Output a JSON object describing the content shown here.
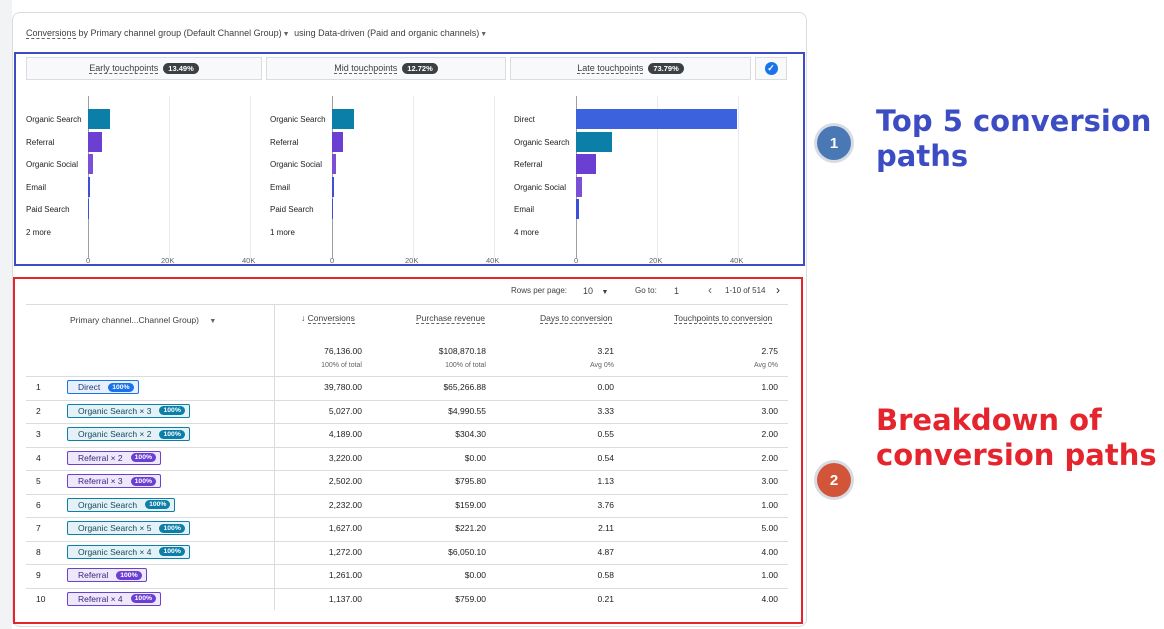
{
  "report": {
    "title_link": "Conversions",
    "title_mid": "by Primary channel group (Default Channel Group)",
    "title_using": "using",
    "title_model": "Data-driven (Paid and organic channels)"
  },
  "touchpoint_tabs": [
    {
      "label": "Early touchpoints",
      "pct": "13.49%"
    },
    {
      "label": "Mid touchpoints",
      "pct": "12.72%"
    },
    {
      "label": "Late touchpoints",
      "pct": "73.79%"
    }
  ],
  "chart_data": [
    {
      "type": "bar",
      "categories": [
        "Organic Search",
        "Referral",
        "Organic Social",
        "Email",
        "Paid Search",
        "2 more"
      ],
      "values": [
        5400,
        3400,
        1200,
        500,
        300,
        80
      ],
      "colors": [
        "#0b7fa8",
        "#6a3fd1",
        "#7b4fd6",
        "#3d4fd8",
        "#3d4fd8",
        "#9aa0a6"
      ],
      "xticks": [
        "0",
        "20K",
        "40K"
      ],
      "xlim": [
        0,
        40000
      ]
    },
    {
      "type": "bar",
      "categories": [
        "Organic Search",
        "Referral",
        "Organic Social",
        "Email",
        "Paid Search",
        "1 more"
      ],
      "values": [
        5400,
        2800,
        900,
        600,
        150,
        80
      ],
      "colors": [
        "#0b7fa8",
        "#6a3fd1",
        "#7b4fd6",
        "#3d4fd8",
        "#3d4fd8",
        "#9aa0a6"
      ],
      "xticks": [
        "0",
        "20K",
        "40K"
      ],
      "xlim": [
        0,
        40000
      ]
    },
    {
      "type": "bar",
      "categories": [
        "Direct",
        "Organic Search",
        "Referral",
        "Organic Social",
        "Email",
        "4 more"
      ],
      "values": [
        39780,
        9000,
        5000,
        1400,
        700,
        150
      ],
      "colors": [
        "#3c63dd",
        "#0b7fa8",
        "#6a3fd1",
        "#7b4fd6",
        "#3d4fd8",
        "#9aa0a6"
      ],
      "xticks": [
        "0",
        "20K",
        "40K"
      ],
      "xlim": [
        0,
        40000
      ]
    }
  ],
  "table": {
    "rows_per_page_label": "Rows per page:",
    "rows_per_page": "10",
    "goto_label": "Go to:",
    "goto_value": "1",
    "range": "1-10 of 514",
    "dimension_header": "Primary channel...Channel Group)",
    "columns": [
      "Conversions",
      "Purchase revenue",
      "Days to conversion",
      "Touchpoints to conversion"
    ],
    "totals": [
      "76,136.00",
      "$108,870.18",
      "3.21",
      "2.75"
    ],
    "totals_sub": [
      "100% of total",
      "100% of total",
      "Avg 0%",
      "Avg 0%"
    ],
    "rows": [
      {
        "n": "1",
        "path": "Direct",
        "pct": "100%",
        "color": "blue",
        "v": [
          "39,780.00",
          "$65,266.88",
          "0.00",
          "1.00"
        ]
      },
      {
        "n": "2",
        "path": "Organic Search × 3",
        "pct": "100%",
        "color": "teal",
        "v": [
          "5,027.00",
          "$4,990.55",
          "3.33",
          "3.00"
        ]
      },
      {
        "n": "3",
        "path": "Organic Search × 2",
        "pct": "100%",
        "color": "teal",
        "v": [
          "4,189.00",
          "$304.30",
          "0.55",
          "2.00"
        ]
      },
      {
        "n": "4",
        "path": "Referral × 2",
        "pct": "100%",
        "color": "purple",
        "v": [
          "3,220.00",
          "$0.00",
          "0.54",
          "2.00"
        ]
      },
      {
        "n": "5",
        "path": "Referral × 3",
        "pct": "100%",
        "color": "purple",
        "v": [
          "2,502.00",
          "$795.80",
          "1.13",
          "3.00"
        ]
      },
      {
        "n": "6",
        "path": "Organic Search",
        "pct": "100%",
        "color": "teal",
        "v": [
          "2,232.00",
          "$159.00",
          "3.76",
          "1.00"
        ]
      },
      {
        "n": "7",
        "path": "Organic Search × 5",
        "pct": "100%",
        "color": "teal",
        "v": [
          "1,627.00",
          "$221.20",
          "2.11",
          "5.00"
        ]
      },
      {
        "n": "8",
        "path": "Organic Search × 4",
        "pct": "100%",
        "color": "teal",
        "v": [
          "1,272.00",
          "$6,050.10",
          "4.87",
          "4.00"
        ]
      },
      {
        "n": "9",
        "path": "Referral",
        "pct": "100%",
        "color": "purple",
        "v": [
          "1,261.00",
          "$0.00",
          "0.58",
          "1.00"
        ]
      },
      {
        "n": "10",
        "path": "Referral × 4",
        "pct": "100%",
        "color": "purple",
        "v": [
          "1,137.00",
          "$759.00",
          "0.21",
          "4.00"
        ]
      }
    ]
  },
  "annotations": {
    "badge1": "1",
    "text1_line1": "Top 5 conversion",
    "text1_line2": "paths",
    "badge2": "2",
    "text2_line1": "Breakdown of",
    "text2_line2": "conversion paths",
    "color1": "#3c4dc4",
    "color2": "#e5252d"
  }
}
